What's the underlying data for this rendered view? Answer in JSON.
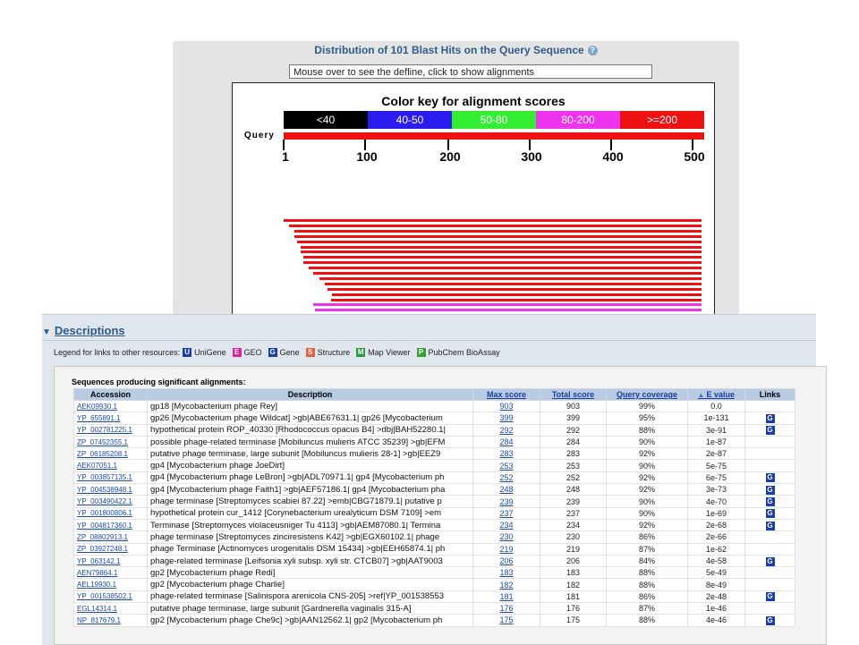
{
  "graphic": {
    "title": "Distribution of 101 Blast Hits on the Query Sequence",
    "help_icon": "?",
    "defline_text": "Mouse over to see the defline, click to show alignments",
    "color_key_title": "Color key for alignment scores",
    "query_label": "Query",
    "color_key": [
      {
        "label": "<40",
        "color": "#000000"
      },
      {
        "label": "40-50",
        "color": "#2b1df0"
      },
      {
        "label": "50-80",
        "color": "#33ee33"
      },
      {
        "label": "80-200",
        "color": "#ee33ee"
      },
      {
        "label": ">=200",
        "color": "#ee1111"
      }
    ],
    "ticks": [
      "1",
      "100",
      "200",
      "300",
      "400",
      "500"
    ],
    "hit_colors": {
      "high": "#ee1111",
      "mid": "#ee33ee"
    }
  },
  "descriptions": {
    "header": "Descriptions",
    "legend_text": "Legend for links to other resources:",
    "legend_items": [
      {
        "icon": "U",
        "label": "UniGene",
        "color": "#1a3ea8"
      },
      {
        "icon": "E",
        "label": "GEO",
        "color": "#e0229a"
      },
      {
        "icon": "G",
        "label": "Gene",
        "color": "#1a3ea8"
      },
      {
        "icon": "S",
        "label": "Structure",
        "color": "#e0603a"
      },
      {
        "icon": "M",
        "label": "Map Viewer",
        "color": "#2a9a3a"
      },
      {
        "icon": "P",
        "label": "PubChem BioAssay",
        "color": "#3aa030"
      }
    ],
    "section_title": "Sequences producing significant alignments:",
    "columns": [
      "Accession",
      "Description",
      "Max score",
      "Total score",
      "Query coverage",
      "E value",
      "Links"
    ],
    "sort_icon": "▲",
    "link_icon_label": "G",
    "rows": [
      {
        "acc": "AEK09930.1",
        "desc": "gp18 [Mycobacterium phage Rey]",
        "max": "903",
        "total": "903",
        "cov": "99%",
        "e": "0.0",
        "g": 0
      },
      {
        "acc": "YP_655891.1",
        "desc": "gp26 [Mycobacterium phage Wildcat] >gb|ABE67631.1| gp26 [Mycobacterium",
        "max": "399",
        "total": "399",
        "cov": "95%",
        "e": "1e-131",
        "g": 1
      },
      {
        "acc": "YP_002781225.1",
        "desc": "hypothetical protein ROP_40330 [Rhodococcus opacus B4] >dbj|BAH52280.1|",
        "max": "292",
        "total": "292",
        "cov": "88%",
        "e": "3e-91",
        "g": 1
      },
      {
        "acc": "ZP_07452355.1",
        "desc": "possible phage-related terminase [Mobiluncus mulieris ATCC 35239] >gb|EFM",
        "max": "284",
        "total": "284",
        "cov": "90%",
        "e": "1e-87",
        "g": 0
      },
      {
        "acc": "ZP_06185208.1",
        "desc": "putative phage terminase, large subunit [Mobiluncus mulieris 28-1] >gb|EEZ9",
        "max": "283",
        "total": "283",
        "cov": "92%",
        "e": "2e-87",
        "g": 0
      },
      {
        "acc": "AEK07051.1",
        "desc": "gp4 [Mycobacterium phage JoeDirt]",
        "max": "253",
        "total": "253",
        "cov": "90%",
        "e": "5e-75",
        "g": 0
      },
      {
        "acc": "YP_003857135.1",
        "desc": "gp4 [Mycobacterium phage LeBron] >gb|ADL70971.1| gp4 [Mycobacterium ph",
        "max": "252",
        "total": "252",
        "cov": "92%",
        "e": "6e-75",
        "g": 1
      },
      {
        "acc": "YP_004538948.1",
        "desc": "gp4 [Mycobacterium phage Faith1] >gb|AEF57186.1| gp4 [Mycobacterium pha",
        "max": "248",
        "total": "248",
        "cov": "92%",
        "e": "3e-73",
        "g": 1
      },
      {
        "acc": "YP_003490422.1",
        "desc": "phage terminase [Streptomyces scabiei 87.22] >emb|CBG71879.1| putative p",
        "max": "239",
        "total": "239",
        "cov": "90%",
        "e": "4e-70",
        "g": 1
      },
      {
        "acc": "YP_001800806.1",
        "desc": "hypothetical protein cur_1412 [Corynebacterium urealyticum DSM 7109] >em",
        "max": "237",
        "total": "237",
        "cov": "90%",
        "e": "1e-69",
        "g": 1
      },
      {
        "acc": "YP_004817360.1",
        "desc": "Terminase [Streptomyces violaceusniger Tu 4113] >gb|AEM87080.1| Termina",
        "max": "234",
        "total": "234",
        "cov": "92%",
        "e": "2e-68",
        "g": 1
      },
      {
        "acc": "ZP_08802913.1",
        "desc": "phage terminase [Streptomyces zinciresistens K42] >gb|EGX60102.1| phage",
        "max": "230",
        "total": "230",
        "cov": "86%",
        "e": "2e-66",
        "g": 0
      },
      {
        "acc": "ZP_03927248.1",
        "desc": "phage Terminase [Actinomyces urogenitalis DSM 15434] >gb|EEH65874.1| ph",
        "max": "219",
        "total": "219",
        "cov": "87%",
        "e": "1e-62",
        "g": 0
      },
      {
        "acc": "YP_063142.1",
        "desc": "phage-related terminase [Leifsonia xyli subsp. xyli str. CTCB07] >gb|AAT9003",
        "max": "206",
        "total": "206",
        "cov": "84%",
        "e": "4e-58",
        "g": 1
      },
      {
        "acc": "AEN79864.1",
        "desc": "gp2 [Mycobacterium phage Redi]",
        "max": "183",
        "total": "183",
        "cov": "88%",
        "e": "5e-49",
        "g": 0
      },
      {
        "acc": "AEL19930.1",
        "desc": "gp2 [Mycobacterium phage Charlie]",
        "max": "182",
        "total": "182",
        "cov": "88%",
        "e": "8e-49",
        "g": 0
      },
      {
        "acc": "YP_001538502.1",
        "desc": "phage-related terminase [Salinispora arenicola CNS-205] >ref|YP_001538553",
        "max": "181",
        "total": "181",
        "cov": "86%",
        "e": "2e-48",
        "g": 1
      },
      {
        "acc": "EGL14314.1",
        "desc": "putative phage terminase, large subunit [Gardnerella vaginalis 315-A]",
        "max": "176",
        "total": "176",
        "cov": "87%",
        "e": "1e-46",
        "g": 0
      },
      {
        "acc": "NP_817679.1",
        "desc": "gp2 [Mycobacterium phage Che9c] >gb|AAN12562.1| gp2 [Mycobacterium ph",
        "max": "175",
        "total": "175",
        "cov": "88%",
        "e": "4e-46",
        "g": 1
      }
    ]
  }
}
